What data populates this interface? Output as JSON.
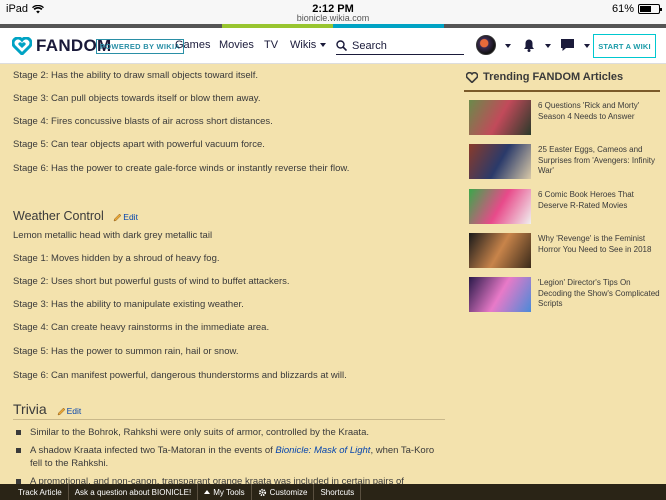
{
  "status_bar": {
    "device": "iPad",
    "time": "2:12 PM",
    "url": "bionicle.wikia.com",
    "battery": "61%",
    "battery_fraction": 0.61
  },
  "stripe_colors": [
    "#555555",
    "#555555",
    "#98c52f",
    "#00a3c4",
    "#555555",
    "#555555"
  ],
  "nav": {
    "logo_text": "FANDOM",
    "powered_by": "POWERED BY WIKIA",
    "links": [
      "Games",
      "Movies",
      "TV",
      "Wikis"
    ],
    "search_label": "Search",
    "start_wiki": "START A WIKI"
  },
  "article": {
    "wind_stages": [
      "Stage 2: Has the ability to draw small objects toward itself.",
      "Stage 3: Can pull objects towards itself or blow them away.",
      "Stage 4: Fires concussive blasts of air across short distances.",
      "Stage 5: Can tear objects apart with powerful vacuum force.",
      "Stage 6: Has the power to create gale-force winds or instantly reverse their flow."
    ],
    "weather_heading": "Weather Control",
    "edit_label": "Edit",
    "weather_desc": "Lemon metallic head with dark grey metallic tail",
    "weather_stages": [
      "Stage 1: Moves hidden by a shroud of heavy fog.",
      "Stage 2: Uses short but powerful gusts of wind to buffet attackers.",
      "Stage 3: Has the ability to manipulate existing weather.",
      "Stage 4: Can create heavy rainstorms in the immediate area.",
      "Stage 5: Has the power to summon rain, hail or snow.",
      "Stage 6: Can manifest powerful, dangerous thunderstorms and blizzards at will."
    ],
    "trivia_heading": "Trivia",
    "trivia": [
      {
        "before": "Similar to the Bohrok, Rahkshi were only suits of armor, controlled by the Kraata.",
        "link": "",
        "after": ""
      },
      {
        "before": "A shadow Kraata infected two Ta-Matoran in the events of ",
        "link": "Bionicle: Mask of Light",
        "after": ", when Ta-Koro fell to the Rahkshi."
      },
      {
        "before": "A promotional, and non-canon, transparant orange kraata was included in certain pairs of",
        "link": "",
        "after": ""
      }
    ]
  },
  "rail": {
    "title": "Trending FANDOM Articles",
    "articles": [
      {
        "title": "6 Questions 'Rick and Morty' Season 4 Needs to Answer",
        "colors": [
          "#6a8a4a",
          "#c24a5a",
          "#2a3a2a"
        ]
      },
      {
        "title": "25 Easter Eggs, Cameos and Surprises from 'Avengers: Infinity War'",
        "colors": [
          "#8a3a2a",
          "#2a3a6a",
          "#d9c9a8"
        ]
      },
      {
        "title": "6 Comic Book Heroes That Deserve R-Rated Movies",
        "colors": [
          "#3aa84a",
          "#e84a8a",
          "#f0f0f0"
        ]
      },
      {
        "title": "Why 'Revenge' is the Feminist Horror You Need to See in 2018",
        "colors": [
          "#1a1a1a",
          "#c8844a",
          "#3a2a1a"
        ]
      },
      {
        "title": "'Legion' Director's Tips On Decoding the Show's Complicated Scripts",
        "colors": [
          "#2a1a4a",
          "#e87ac8",
          "#4a8ad8"
        ]
      }
    ]
  },
  "toolbar": {
    "items": [
      "Track Article",
      "Ask a question about BIONICLE!",
      "My Tools",
      "Customize",
      "Shortcuts"
    ]
  }
}
